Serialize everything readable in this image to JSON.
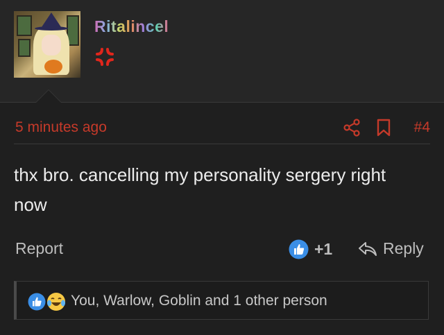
{
  "user": {
    "name": "Ritalincel",
    "avatar_icon": "anime-avatar",
    "status_icon": "anger-symbol-icon"
  },
  "post": {
    "timestamp": "5 minutes ago",
    "number": "#4",
    "body": "thx bro. cancelling my personality sergery right now"
  },
  "actions": {
    "report": "Report",
    "like_count": "+1",
    "reply": "Reply"
  },
  "reactions": {
    "summary": "You, Warlow, Goblin and 1 other person",
    "icons": [
      "like-icon",
      "laugh-cry-icon"
    ]
  },
  "colors": {
    "accent_red": "#c63a2a",
    "like_blue": "#3a8ee6",
    "background": "#1f1f1f"
  }
}
